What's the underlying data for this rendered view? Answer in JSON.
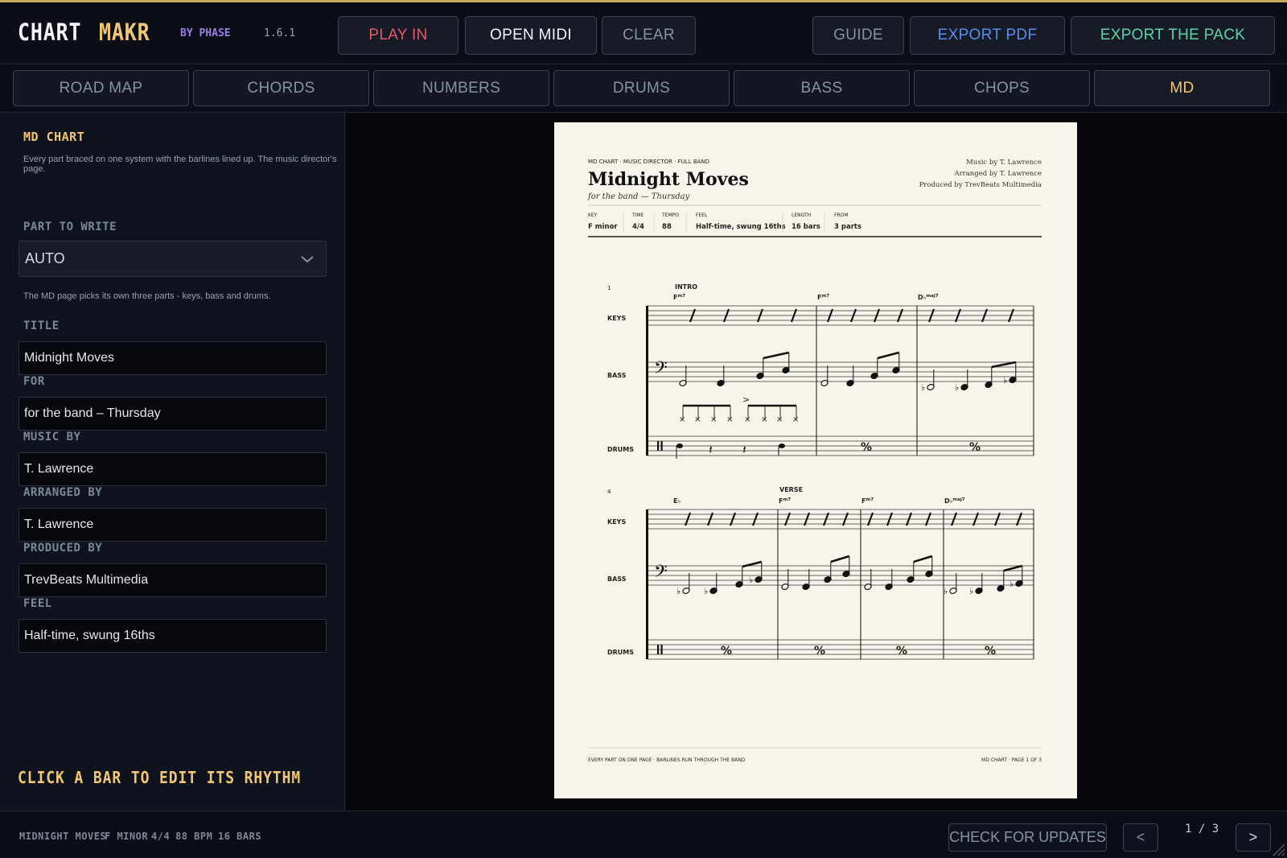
{
  "header": {
    "brand_part1": "CHART",
    "brand_part2": "MAKR",
    "by_line": "BY PHASE",
    "version": "1.6.1",
    "buttons": {
      "play_in": "PLAY IN",
      "open_midi": "OPEN MIDI",
      "clear": "CLEAR",
      "guide": "GUIDE",
      "export_pdf": "EXPORT PDF",
      "export_pack": "EXPORT THE PACK"
    },
    "colors": {
      "play_in": "#e8576a",
      "export_pdf": "#5b8def",
      "export_pack": "#5fd3a4",
      "accent": "#f0c674"
    }
  },
  "tabs": [
    {
      "label": "ROAD MAP"
    },
    {
      "label": "CHORDS"
    },
    {
      "label": "NUMBERS"
    },
    {
      "label": "DRUMS"
    },
    {
      "label": "BASS"
    },
    {
      "label": "CHOPS"
    },
    {
      "label": "MD",
      "active": true
    }
  ],
  "sidebar": {
    "title": "MD CHART",
    "description": "Every part braced on one system with the barlines lined up. The music director's page.",
    "part_label": "PART TO WRITE",
    "part_value": "AUTO",
    "part_hint": "The MD page picks its own three parts - keys, bass and drums.",
    "fields": {
      "title_label": "TITLE",
      "title_value": "Midnight Moves",
      "for_label": "FOR",
      "for_value": "for the band – Thursday",
      "music_label": "MUSIC BY",
      "music_value": "T. Lawrence",
      "arranged_label": "ARRANGED BY",
      "arranged_value": "T. Lawrence",
      "produced_label": "PRODUCED BY",
      "produced_value": "TrevBeats Multimedia",
      "feel_label": "FEEL",
      "feel_value": "Half-time, swung 16ths"
    },
    "click_hint": "CLICK A BAR TO EDIT ITS RHYTHM"
  },
  "sheet": {
    "kicker": "MD CHART · MUSIC DIRECTOR · FULL BAND",
    "title": "Midnight Moves",
    "subtitle": "for the band — Thursday",
    "credits": [
      "Music by T. Lawrence",
      "Arranged by T. Lawrence",
      "Produced by TrevBeats Multimedia"
    ],
    "meta": [
      {
        "label": "KEY",
        "value": "F minor"
      },
      {
        "label": "TIME",
        "value": "4/4"
      },
      {
        "label": "TEMPO",
        "value": "88"
      },
      {
        "label": "FEEL",
        "value": "Half-time, swung 16ths"
      },
      {
        "label": "LENGTH",
        "value": "16 bars"
      },
      {
        "label": "FROM",
        "value": "3 parts"
      }
    ],
    "parts": [
      "KEYS",
      "BASS",
      "DRUMS"
    ],
    "system1": {
      "bar_number": "1",
      "section": "INTRO",
      "chords": [
        {
          "root": "F",
          "quality": "m7"
        },
        {
          "root": "F",
          "quality": "m7"
        },
        {
          "root": "D♭",
          "quality": "maj7"
        }
      ]
    },
    "system2": {
      "bar_number": "4",
      "section": "VERSE",
      "chords": [
        {
          "root": "E♭",
          "quality": ""
        },
        {
          "root": "F",
          "quality": "m7"
        },
        {
          "root": "F",
          "quality": "m7"
        },
        {
          "root": "D♭",
          "quality": "maj7"
        }
      ]
    },
    "footer_left": "EVERY PART ON ONE PAGE · BARLINES RUN THROUGH THE BAND",
    "footer_right": "MD CHART · PAGE 1 OF 3"
  },
  "status": {
    "song": "MIDNIGHT MOVES",
    "key": "F MINOR",
    "time": "4/4",
    "tempo": "88 BPM",
    "length": "16 BARS",
    "check_updates": "CHECK FOR UPDATES",
    "prev": "<",
    "next": ">",
    "page": "1 / 3"
  }
}
